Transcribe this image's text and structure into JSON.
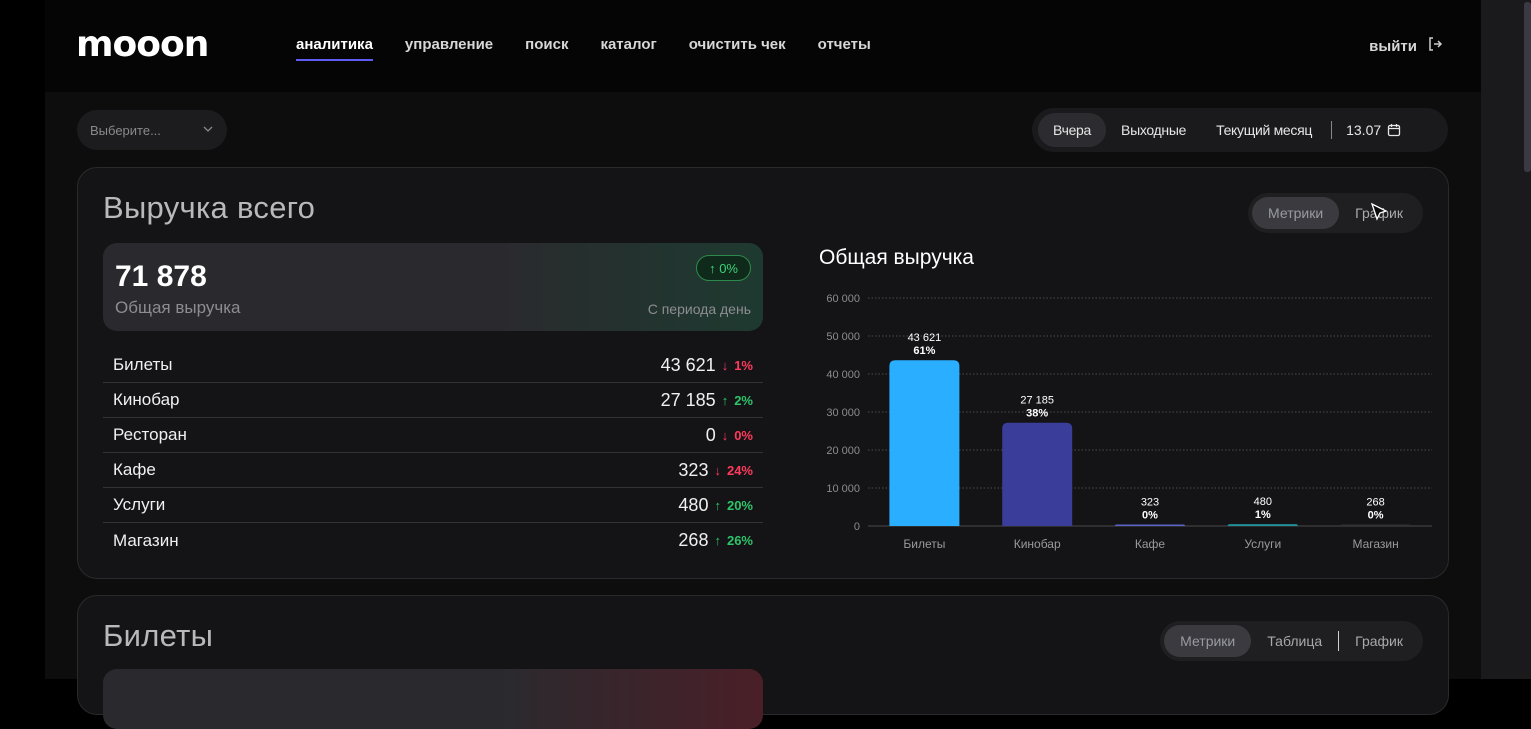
{
  "brand": {
    "logo": "mooon"
  },
  "nav": {
    "items": [
      {
        "label": "аналитика",
        "active": true
      },
      {
        "label": "управление",
        "active": false
      },
      {
        "label": "поиск",
        "active": false
      },
      {
        "label": "каталог",
        "active": false
      },
      {
        "label": "очистить чек",
        "active": false
      },
      {
        "label": "отчеты",
        "active": false
      }
    ],
    "logout_label": "выйти"
  },
  "filters": {
    "select_placeholder": "Выберите...",
    "periods": [
      "Вчера",
      "Выходные",
      "Текущий месяц"
    ],
    "active_period": "Вчера",
    "date": "13.07"
  },
  "revenue_card": {
    "title": "Выручка всего",
    "toggle": [
      "Метрики",
      "График"
    ],
    "active_toggle": "Метрики",
    "total": {
      "value": "71 878",
      "label": "Общая выручка",
      "change": "↑ 0%",
      "period_note": "С периода день"
    },
    "rows": [
      {
        "name": "Билеты",
        "value": "43 621",
        "arrow": "↓",
        "pct": "1%",
        "dir": "down"
      },
      {
        "name": "Кинобар",
        "value": "27 185",
        "arrow": "↑",
        "pct": "2%",
        "dir": "up"
      },
      {
        "name": "Ресторан",
        "value": "0",
        "arrow": "↓",
        "pct": "0%",
        "dir": "down"
      },
      {
        "name": "Кафе",
        "value": "323",
        "arrow": "↓",
        "pct": "24%",
        "dir": "down"
      },
      {
        "name": "Услуги",
        "value": "480",
        "arrow": "↑",
        "pct": "20%",
        "dir": "up"
      },
      {
        "name": "Магазин",
        "value": "268",
        "arrow": "↑",
        "pct": "26%",
        "dir": "up"
      }
    ]
  },
  "chart_data": {
    "type": "bar",
    "title": "Общая выручка",
    "categories": [
      "Билеты",
      "Кинобар",
      "Кафе",
      "Услуги",
      "Магазин"
    ],
    "values": [
      43621,
      27185,
      323,
      480,
      268
    ],
    "value_labels": [
      "43 621",
      "27 185",
      "323",
      "480",
      "268"
    ],
    "pct_labels": [
      "61%",
      "38%",
      "0%",
      "1%",
      "0%"
    ],
    "colors": [
      "#2aaeff",
      "#3a3d9a",
      "#5a63c8",
      "#1f8f99",
      "#303036"
    ],
    "ylim": [
      0,
      60000
    ],
    "yticks": [
      "0",
      "10 000",
      "20 000",
      "30 000",
      "40 000",
      "50 000",
      "60 000"
    ],
    "grid": true
  },
  "tickets_card": {
    "title": "Билеты",
    "toggle": [
      "Метрики",
      "Таблица",
      "График"
    ],
    "active_toggle": "Метрики"
  }
}
